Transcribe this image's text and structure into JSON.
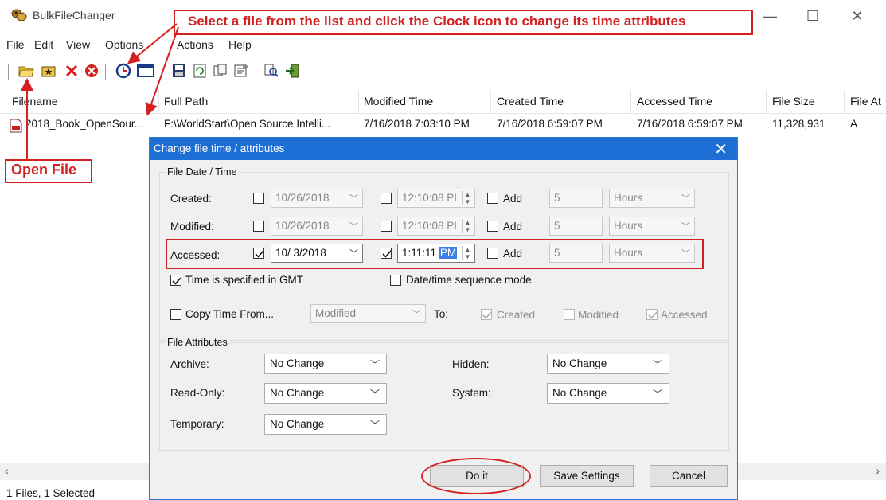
{
  "window": {
    "title": "BulkFileChanger",
    "minimize_glyph": "—",
    "maximize_glyph": "☐",
    "close_glyph": "✕"
  },
  "menu": [
    "File",
    "Edit",
    "View",
    "Options",
    "Actions",
    "Help"
  ],
  "toolbar_icons": [
    "open-folder-icon",
    "add-folder-icon",
    "delete-icon",
    "clear-icon",
    "clock-icon",
    "window-icon",
    "save-icon",
    "refresh-icon",
    "copy-icon",
    "properties-icon",
    "search-icon",
    "exit-icon"
  ],
  "list": {
    "columns": [
      "Filename",
      "Full Path",
      "Modified Time",
      "Created Time",
      "Accessed Time",
      "File Size",
      "File At"
    ],
    "rows": [
      {
        "filename": "2018_Book_OpenSour...",
        "full_path": "F:\\WorldStart\\Open Source Intelli...",
        "modified": "7/16/2018 7:03:10 PM",
        "created": "7/16/2018 6:59:07 PM",
        "accessed": "7/16/2018 6:59:07 PM",
        "size": "11,328,931",
        "attr": "A"
      }
    ]
  },
  "status": "1 Files, 1 Selected",
  "annotations": {
    "top": "Select a file from the list and click the Clock icon to change its time attributes",
    "open_file": "Open File"
  },
  "dialog": {
    "title": "Change file time / attributes",
    "close_glyph": "✕",
    "date_group": "File Date / Time",
    "rows": [
      {
        "label": "Created:",
        "date": "10/26/2018",
        "time": "12:10:08 PI",
        "add": "Add",
        "amount": "5",
        "unit": "Hours",
        "date_checked": false,
        "time_checked": false
      },
      {
        "label": "Modified:",
        "date": "10/26/2018",
        "time": "12:10:08 PI",
        "add": "Add",
        "amount": "5",
        "unit": "Hours",
        "date_checked": false,
        "time_checked": false
      },
      {
        "label": "Accessed:",
        "date": "10/ 3/2018",
        "time": "1:11:11",
        "time_ampm": "PM",
        "add": "Add",
        "amount": "5",
        "unit": "Hours",
        "date_checked": true,
        "time_checked": true
      }
    ],
    "gmt_label": "Time is specified in GMT",
    "sequence_label": "Date/time sequence mode",
    "copy_from_label": "Copy Time From...",
    "copy_from_value": "Modified",
    "to_label": "To:",
    "to_created": "Created",
    "to_modified": "Modified",
    "to_accessed": "Accessed",
    "attr_group": "File Attributes",
    "attrs": {
      "archive_label": "Archive:",
      "archive_value": "No Change",
      "readonly_label": "Read-Only:",
      "readonly_value": "No Change",
      "temporary_label": "Temporary:",
      "temporary_value": "No Change",
      "hidden_label": "Hidden:",
      "hidden_value": "No Change",
      "system_label": "System:",
      "system_value": "No Change"
    },
    "buttons": {
      "do_it": "Do it",
      "save_settings": "Save Settings",
      "cancel": "Cancel"
    }
  },
  "colors": {
    "annotation_red": "#d42020",
    "dialog_title_blue": "#1d6fd6",
    "selection_blue": "#3b7ee6"
  }
}
